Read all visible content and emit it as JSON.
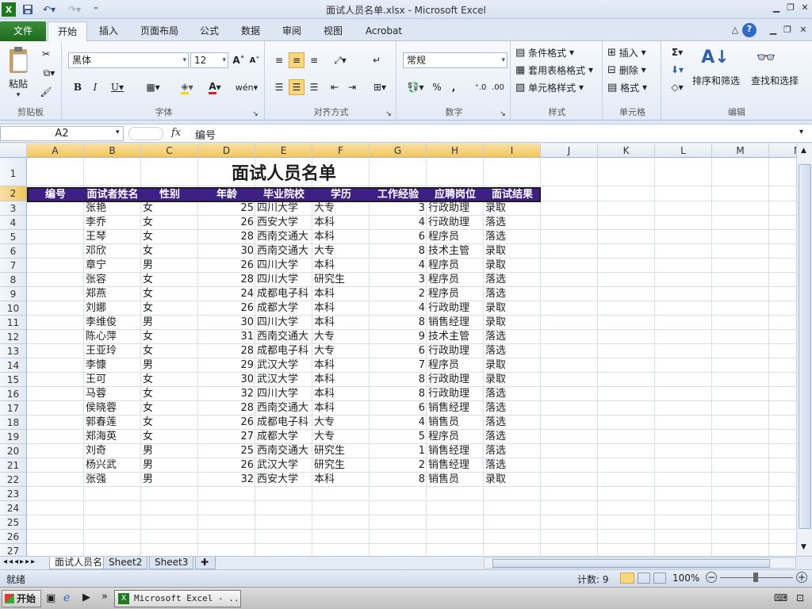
{
  "window": {
    "title": "面试人员名单.xlsx - Microsoft Excel",
    "app_icon": "excel-icon",
    "controls": [
      "minimize",
      "restore",
      "close"
    ]
  },
  "quick_access": {
    "items": [
      "save-icon",
      "undo-icon",
      "redo-icon",
      "customize-icon"
    ]
  },
  "tabs": {
    "file": "文件",
    "home": "开始",
    "insert": "插入",
    "layout": "页面布局",
    "formulas": "公式",
    "data": "数据",
    "review": "审阅",
    "view": "视图",
    "acrobat": "Acrobat"
  },
  "ribbon": {
    "clipboard": {
      "label": "剪贴板",
      "paste": "粘贴"
    },
    "font": {
      "label": "字体",
      "name": "黑体",
      "size": "12"
    },
    "alignment": {
      "label": "对齐方式"
    },
    "number": {
      "label": "数字",
      "format": "常规",
      "percent": "%",
      "comma": ","
    },
    "styles": {
      "label": "样式",
      "conditional": "条件格式",
      "table": "套用表格格式",
      "cell_styles": "单元格样式"
    },
    "cells": {
      "label": "单元格",
      "insert": "插入",
      "delete": "删除",
      "format": "格式"
    },
    "editing": {
      "label": "编辑",
      "sort_filter": "排序和筛选",
      "find_select": "查找和选择",
      "sigma": "Σ"
    }
  },
  "formula_bar": {
    "name_box": "A2",
    "fx": "fx",
    "value": "编号"
  },
  "sheet": {
    "columns": [
      "A",
      "B",
      "C",
      "D",
      "E",
      "F",
      "G",
      "H",
      "I",
      "J",
      "K",
      "L",
      "M",
      "N"
    ],
    "row_numbers": [
      "1",
      "2",
      "3",
      "4",
      "5",
      "6",
      "7",
      "8",
      "9",
      "10",
      "11",
      "12",
      "13",
      "14",
      "15",
      "16",
      "17",
      "18",
      "19",
      "20",
      "21",
      "22",
      "23",
      "24",
      "25",
      "26",
      "27"
    ],
    "title": "面试人员名单",
    "headers": [
      "编号",
      "面试者姓名",
      "性别",
      "年龄",
      "毕业院校",
      "学历",
      "工作经验",
      "应聘岗位",
      "面试结果"
    ],
    "rows": [
      [
        "",
        "张艳",
        "女",
        "25",
        "四川大学",
        "大专",
        "3",
        "行政助理",
        "录取"
      ],
      [
        "",
        "李乔",
        "女",
        "26",
        "西安大学",
        "本科",
        "4",
        "行政助理",
        "落选"
      ],
      [
        "",
        "王琴",
        "女",
        "28",
        "西南交通大",
        "本科",
        "6",
        "程序员",
        "落选"
      ],
      [
        "",
        "邓欣",
        "女",
        "30",
        "西南交通大",
        "大专",
        "8",
        "技术主管",
        "录取"
      ],
      [
        "",
        "章宁",
        "男",
        "26",
        "四川大学",
        "本科",
        "4",
        "程序员",
        "录取"
      ],
      [
        "",
        "张容",
        "女",
        "28",
        "四川大学",
        "研究生",
        "3",
        "程序员",
        "落选"
      ],
      [
        "",
        "郑燕",
        "女",
        "24",
        "成都电子科",
        "本科",
        "2",
        "程序员",
        "落选"
      ],
      [
        "",
        "刘娜",
        "女",
        "26",
        "成都大学",
        "本科",
        "4",
        "行政助理",
        "录取"
      ],
      [
        "",
        "李维俊",
        "男",
        "30",
        "四川大学",
        "本科",
        "8",
        "销售经理",
        "录取"
      ],
      [
        "",
        "陈心萍",
        "女",
        "31",
        "西南交通大",
        "大专",
        "9",
        "技术主管",
        "落选"
      ],
      [
        "",
        "王亚玲",
        "女",
        "28",
        "成都电子科",
        "大专",
        "6",
        "行政助理",
        "落选"
      ],
      [
        "",
        "李慷",
        "男",
        "29",
        "武汉大学",
        "本科",
        "7",
        "程序员",
        "录取"
      ],
      [
        "",
        "王可",
        "女",
        "30",
        "武汉大学",
        "本科",
        "8",
        "行政助理",
        "录取"
      ],
      [
        "",
        "马蓉",
        "女",
        "32",
        "四川大学",
        "本科",
        "8",
        "行政助理",
        "落选"
      ],
      [
        "",
        "侯晓蓉",
        "女",
        "28",
        "西南交通大",
        "本科",
        "6",
        "销售经理",
        "落选"
      ],
      [
        "",
        "郭春莲",
        "女",
        "26",
        "成都电子科",
        "大专",
        "4",
        "销售员",
        "落选"
      ],
      [
        "",
        "郑海英",
        "女",
        "27",
        "成都大学",
        "大专",
        "5",
        "程序员",
        "落选"
      ],
      [
        "",
        "刘奇",
        "男",
        "25",
        "西南交通大",
        "研究生",
        "1",
        "销售经理",
        "落选"
      ],
      [
        "",
        "杨兴武",
        "男",
        "26",
        "武汉大学",
        "研究生",
        "2",
        "销售经理",
        "落选"
      ],
      [
        "",
        "张强",
        "男",
        "32",
        "西安大学",
        "本科",
        "8",
        "销售员",
        "录取"
      ]
    ]
  },
  "sheet_tabs": [
    "面试人员名单",
    "Sheet2",
    "Sheet3"
  ],
  "status": {
    "ready": "就绪",
    "count": "计数: 9",
    "zoom": "100%"
  },
  "taskbar": {
    "start": "开始",
    "excel_task": "Microsoft Excel - ..."
  },
  "colors": {
    "header_band": "#3e1f86",
    "file_tab": "#2a7a2a",
    "selection": "#f2c65a"
  }
}
